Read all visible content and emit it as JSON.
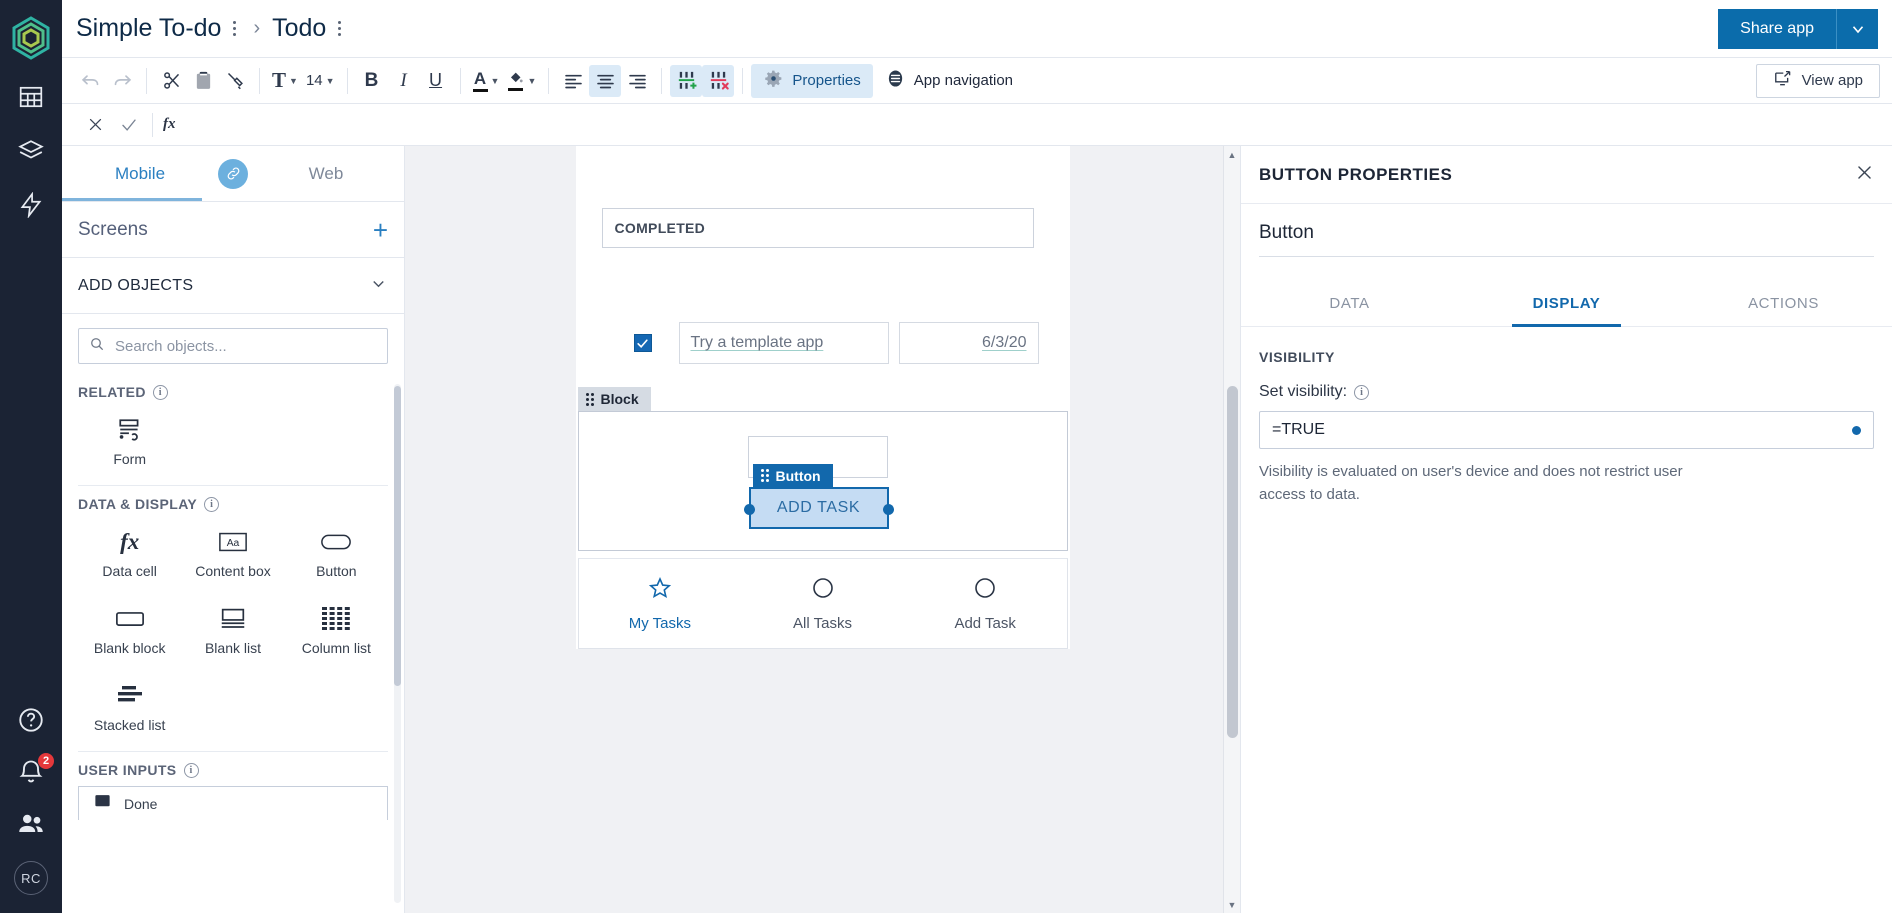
{
  "rail": {
    "logo_icon": "hexagon-logo-icon",
    "items": [
      {
        "name": "tables-icon"
      },
      {
        "name": "layers-icon"
      },
      {
        "name": "automation-bolt-icon"
      }
    ],
    "bottom": [
      {
        "name": "help-icon"
      },
      {
        "name": "notifications-bell-icon",
        "badge": "2"
      },
      {
        "name": "people-icon"
      }
    ],
    "avatar_initials": "RC"
  },
  "header": {
    "app_title": "Simple To-do",
    "screen_title": "Todo",
    "separator": "›",
    "share_label": "Share app",
    "share_caret_icon": "chevron-down-icon"
  },
  "toolbar": {
    "undo_icon": "undo-icon",
    "redo_icon": "redo-icon",
    "cut_icon": "cut-scissors-icon",
    "paste_icon": "paste-clipboard-icon",
    "format_painter_icon": "format-painter-icon",
    "font_icon": "font-T-icon",
    "font_size": "14",
    "bold_label": "B",
    "italic_label": "I",
    "underline_label": "U",
    "text_color_label": "A",
    "fill_color_icon": "fill-bucket-icon",
    "align_left_icon": "align-left-icon",
    "align_center_icon": "align-center-icon",
    "align_right_icon": "align-right-icon",
    "add_column_icon": "add-column-icon",
    "delete_column_icon": "delete-column-icon",
    "properties_label": "Properties",
    "properties_icon": "gear-icon",
    "app_navigation_label": "App navigation",
    "app_navigation_icon": "app-navigation-icon",
    "view_app_label": "View app",
    "view_app_icon": "external-screen-icon"
  },
  "formula_bar": {
    "cancel_icon": "close-x-icon",
    "accept_icon": "check-icon",
    "fx_label": "fx",
    "value": "",
    "placeholder": ""
  },
  "left_panel": {
    "device_tabs": [
      {
        "label": "Mobile",
        "active": true
      },
      {
        "label": "Web",
        "active": false
      }
    ],
    "link_icon": "link-chain-icon",
    "screens_label": "Screens",
    "screens_add_icon": "plus-icon",
    "add_objects_label": "ADD OBJECTS",
    "add_objects_chevron": "chevron-down-icon",
    "search_placeholder": "Search objects...",
    "search_value": "",
    "search_icon": "search-icon",
    "sections": [
      {
        "title": "RELATED",
        "items": [
          {
            "label": "Form",
            "icon": "form-icon"
          }
        ]
      },
      {
        "title": "DATA & DISPLAY",
        "items": [
          {
            "label": "Data cell",
            "icon": "fx-icon"
          },
          {
            "label": "Content box",
            "icon": "content-box-aa-icon"
          },
          {
            "label": "Button",
            "icon": "button-pill-icon"
          },
          {
            "label": "Blank block",
            "icon": "blank-block-icon"
          },
          {
            "label": "Blank list",
            "icon": "blank-list-icon"
          },
          {
            "label": "Column list",
            "icon": "column-list-icon"
          },
          {
            "label": "Stacked list",
            "icon": "stacked-list-icon"
          }
        ]
      },
      {
        "title": "USER INPUTS",
        "items": [
          {
            "label": "Done",
            "icon": "checkbox-input-icon"
          }
        ]
      }
    ]
  },
  "canvas": {
    "section_header": "COMPLETED",
    "task": {
      "checked": true,
      "name": "Try a template app",
      "date": "6/3/20"
    },
    "block_tag": "Block",
    "block_tag_handle_icon": "drag-dots-icon",
    "button_tag": "Button",
    "button_tag_handle_icon": "drag-dots-icon",
    "selected_button_label": "ADD TASK",
    "bottom_nav": [
      {
        "label": "My Tasks",
        "icon": "star-icon",
        "active": true
      },
      {
        "label": "All Tasks",
        "icon": "circle-icon",
        "active": false
      },
      {
        "label": "Add Task",
        "icon": "circle-icon",
        "active": false
      }
    ],
    "scroll_up_icon": "caret-up-icon",
    "scroll_down_icon": "caret-down-icon"
  },
  "right_panel": {
    "title": "BUTTON PROPERTIES",
    "close_icon": "close-x-icon",
    "object_name": "Button",
    "object_name_placeholder": "Name",
    "tabs": [
      {
        "label": "DATA",
        "active": false
      },
      {
        "label": "DISPLAY",
        "active": true
      },
      {
        "label": "ACTIONS",
        "active": false
      }
    ],
    "section_title": "VISIBILITY",
    "field_label": "Set visibility:",
    "field_info_icon": "info-icon",
    "field_value": "=TRUE",
    "field_placeholder": "",
    "field_dot_icon": "formula-dot-icon",
    "help_text": "Visibility is evaluated on user's device and does not restrict user access to data."
  },
  "colors": {
    "brand_dark": "#1b2334",
    "accent_blue": "#1268ac",
    "share_blue": "#0b6cab",
    "canvas_bg": "#f0f1f4",
    "selection_fill": "#c5dcf3",
    "badge_red": "#e5383b"
  }
}
